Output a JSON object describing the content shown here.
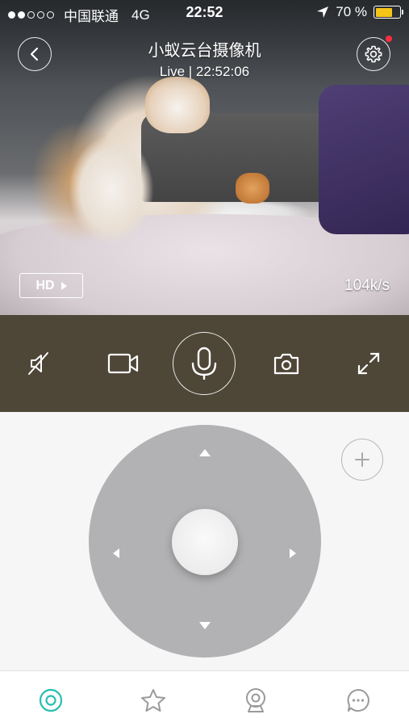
{
  "status_bar": {
    "signal_dots_filled": 2,
    "signal_dots_total": 5,
    "carrier": "中国联通",
    "network": "4G",
    "time": "22:52",
    "battery_percent": "70 %",
    "battery_level": 0.7,
    "location_icon": "location-arrow-icon"
  },
  "header": {
    "title": "小蚁云台摄像机",
    "subtitle": "Live | 22:52:06",
    "back_icon": "chevron-left-icon",
    "settings_icon": "gear-icon",
    "settings_badge_color": "#ff2d3f"
  },
  "video": {
    "quality_label": "HD",
    "bitrate": "104k/s"
  },
  "controls": {
    "background": "#4e4637",
    "items": [
      "mute-icon",
      "video-record-icon",
      "microphone-icon",
      "camera-snapshot-icon",
      "fullscreen-icon"
    ]
  },
  "ptz": {
    "joystick_color": "#b2b2b5",
    "directions": [
      "up",
      "down",
      "left",
      "right"
    ],
    "zoom_icon": "plus-icon"
  },
  "bottom_nav": {
    "items": [
      "home-icon",
      "star-icon",
      "camera-icon",
      "message-icon"
    ],
    "active_index": 0,
    "accent_color": "#26bfb0"
  }
}
